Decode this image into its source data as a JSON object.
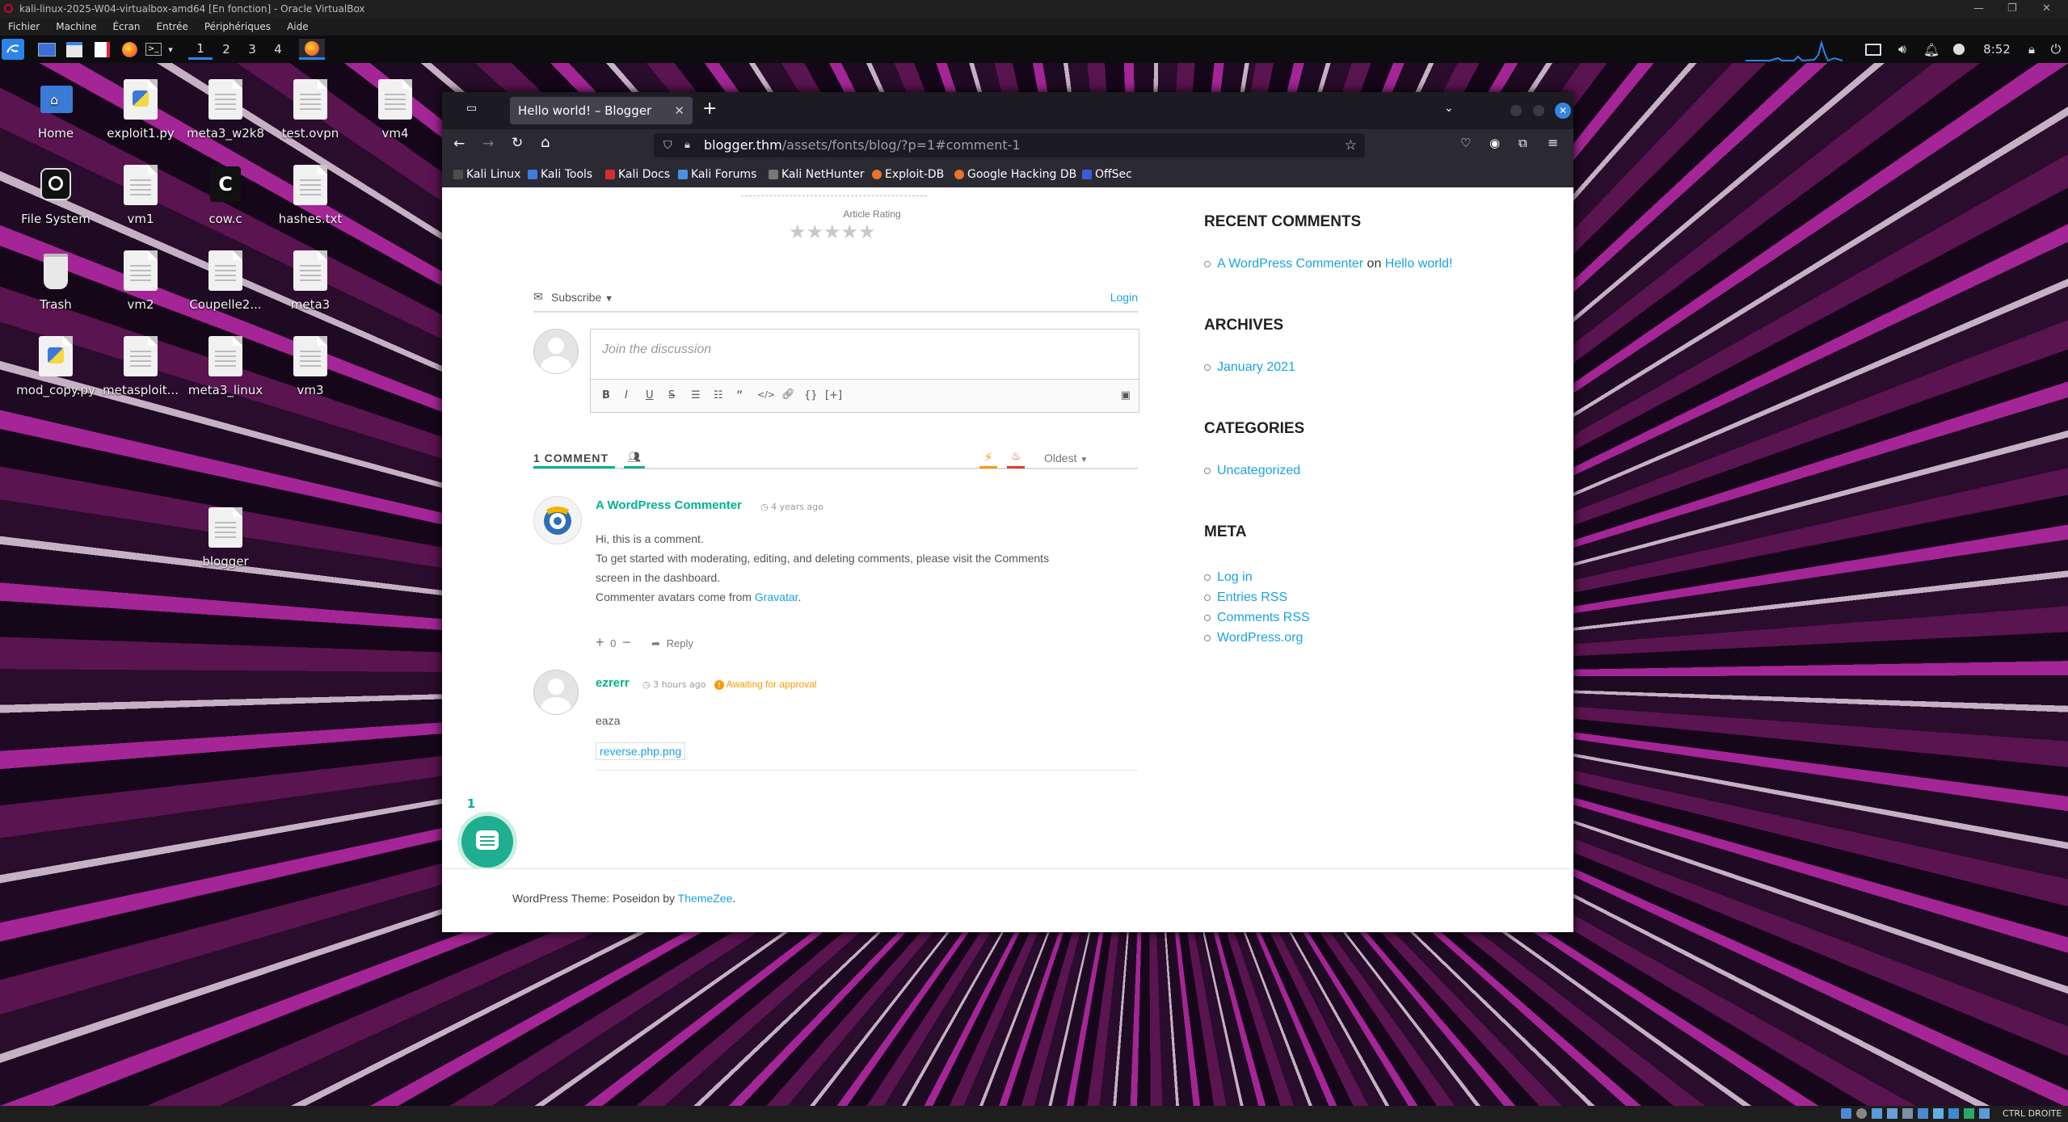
{
  "vbox": {
    "title": "kali-linux-2025-W04-virtualbox-amd64 [En fonction] - Oracle VirtualBox",
    "menu": [
      "Fichier",
      "Machine",
      "Écran",
      "Entrée",
      "Périphériques",
      "Aide"
    ],
    "status_right": "CTRL DROITE"
  },
  "panel": {
    "workspaces": [
      "1",
      "2",
      "3",
      "4"
    ],
    "active_workspace": "1",
    "clock": "8:52"
  },
  "desktop": {
    "icons": [
      {
        "label": "Home",
        "kind": "folder"
      },
      {
        "label": "exploit1.py",
        "kind": "python"
      },
      {
        "label": "meta3_w2k8",
        "kind": "doc"
      },
      {
        "label": "test.ovpn",
        "kind": "doc"
      },
      {
        "label": "vm4",
        "kind": "doc"
      },
      {
        "label": "File System",
        "kind": "drive"
      },
      {
        "label": "vm1",
        "kind": "doc"
      },
      {
        "label": "cow.c",
        "kind": "c"
      },
      {
        "label": "hashes.txt",
        "kind": "doc"
      },
      {
        "label": "Trash",
        "kind": "trash"
      },
      {
        "label": "vm2",
        "kind": "doc"
      },
      {
        "label": "Coupelle2...",
        "kind": "doc"
      },
      {
        "label": "meta3",
        "kind": "doc"
      },
      {
        "label": "mod_copy.py",
        "kind": "python"
      },
      {
        "label": "metasploit...",
        "kind": "doc"
      },
      {
        "label": "meta3_linux",
        "kind": "doc"
      },
      {
        "label": "vm3",
        "kind": "doc"
      },
      {
        "label": "blogger",
        "kind": "doc"
      }
    ]
  },
  "browser": {
    "tab_title": "Hello world! – Blogger",
    "url_host": "blogger.thm",
    "url_path": "/assets/fonts/blog/?p=1#comment-1",
    "bookmarks": [
      "Kali Linux",
      "Kali Tools",
      "Kali Docs",
      "Kali Forums",
      "Kali NetHunter",
      "Exploit-DB",
      "Google Hacking DB",
      "OffSec"
    ]
  },
  "article": {
    "rating_label": "Article Rating",
    "stars": 5
  },
  "comments": {
    "subscribe_label": "Subscribe",
    "login_label": "Login",
    "placeholder": "Join the discussion",
    "toolbar": [
      "B",
      "I",
      "U",
      "S",
      "1.",
      "•",
      "”",
      "</>",
      "link",
      "{}",
      "[+]"
    ],
    "count_label": "1 COMMENT",
    "sort_label": "Oldest",
    "items": [
      {
        "author": "A WordPress Commenter",
        "time": "4 years ago",
        "lines": [
          "Hi, this is a comment.",
          "To get started with moderating, editing, and deleting comments, please visit the Comments",
          "screen in the dashboard.",
          "Commenter avatars come from "
        ],
        "gravatar_link": "Gravatar",
        "votes": "0",
        "reply": "Reply"
      },
      {
        "author": "ezrerr",
        "time": "3 hours ago",
        "status": "Awaiting for approval",
        "text": "eaza",
        "attachment": "reverse.php.png"
      }
    ],
    "bubble_count": "1"
  },
  "sidebar": {
    "recent_comments_title": "RECENT COMMENTS",
    "recent_comment_author": "A WordPress Commenter",
    "recent_comment_on": "on",
    "recent_comment_post": "Hello world!",
    "archives_title": "ARCHIVES",
    "archives": [
      "January 2021"
    ],
    "categories_title": "CATEGORIES",
    "categories": [
      "Uncategorized"
    ],
    "meta_title": "META",
    "meta": [
      "Log in",
      "Entries RSS",
      "Comments RSS",
      "WordPress.org"
    ]
  },
  "footer": {
    "prefix": "WordPress Theme: Poseidon by ",
    "link": "ThemeZee",
    "suffix": "."
  },
  "colors": {
    "accent_green": "#00b38f",
    "link_blue": "#1ba1e2",
    "pending_orange": "#ff9800"
  }
}
